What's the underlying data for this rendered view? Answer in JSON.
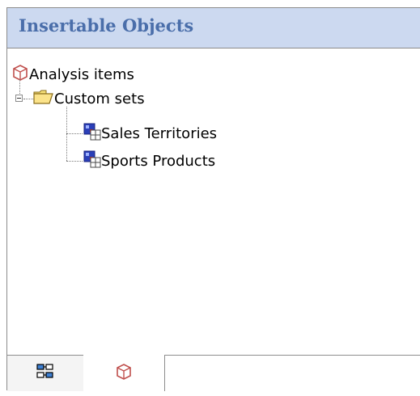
{
  "header": {
    "title": "Insertable Objects"
  },
  "tree": {
    "root": {
      "label": "Analysis items",
      "icon": "cube-icon"
    },
    "folder": {
      "label": "Custom sets",
      "icon": "open-folder-icon",
      "expanded": true
    },
    "children": [
      {
        "label": "Sales Territories",
        "icon": "custom-set-icon"
      },
      {
        "label": "Sports Products",
        "icon": "custom-set-icon"
      }
    ]
  },
  "tabs": [
    {
      "name": "source-tab",
      "icon": "hierarchy-icon",
      "active": false
    },
    {
      "name": "analysis-items-tab",
      "icon": "cube-icon",
      "active": true
    }
  ],
  "colors": {
    "header_bg": "#ccd9f0",
    "header_text": "#4a6eaa",
    "border": "#8c8c8c"
  }
}
